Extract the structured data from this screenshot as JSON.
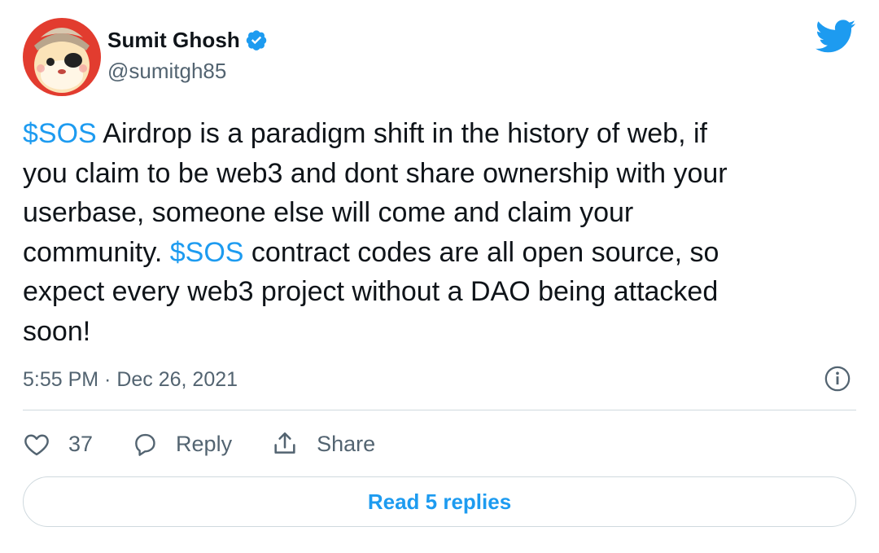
{
  "author": {
    "display_name": "Sumit Ghosh",
    "handle": "@sumitgh85",
    "verified_icon": "verified-badge-icon"
  },
  "tweet": {
    "segments": [
      {
        "text": "$SOS",
        "type": "cashtag"
      },
      {
        "text": " Airdrop is a paradigm shift in the history of web, if\nyou claim to be web3 and dont share ownership with your\nuserbase, someone else will come and claim your\ncommunity. ",
        "type": "text"
      },
      {
        "text": "$SOS",
        "type": "cashtag"
      },
      {
        "text": " contract codes are all open source, so\nexpect every web3 project without a DAO being attacked\nsoon!",
        "type": "text"
      }
    ],
    "timestamp": "5:55 PM · Dec 26, 2021"
  },
  "actions": {
    "like_count": "37",
    "reply_label": "Reply",
    "share_label": "Share"
  },
  "read_replies_label": "Read 5 replies",
  "colors": {
    "accent": "#1d9bf0",
    "text": "#0f1419",
    "secondary": "#536471",
    "border": "#cfd9de"
  },
  "icons": [
    "twitter-bird-icon",
    "info-icon",
    "heart-icon",
    "reply-icon",
    "share-icon"
  ]
}
